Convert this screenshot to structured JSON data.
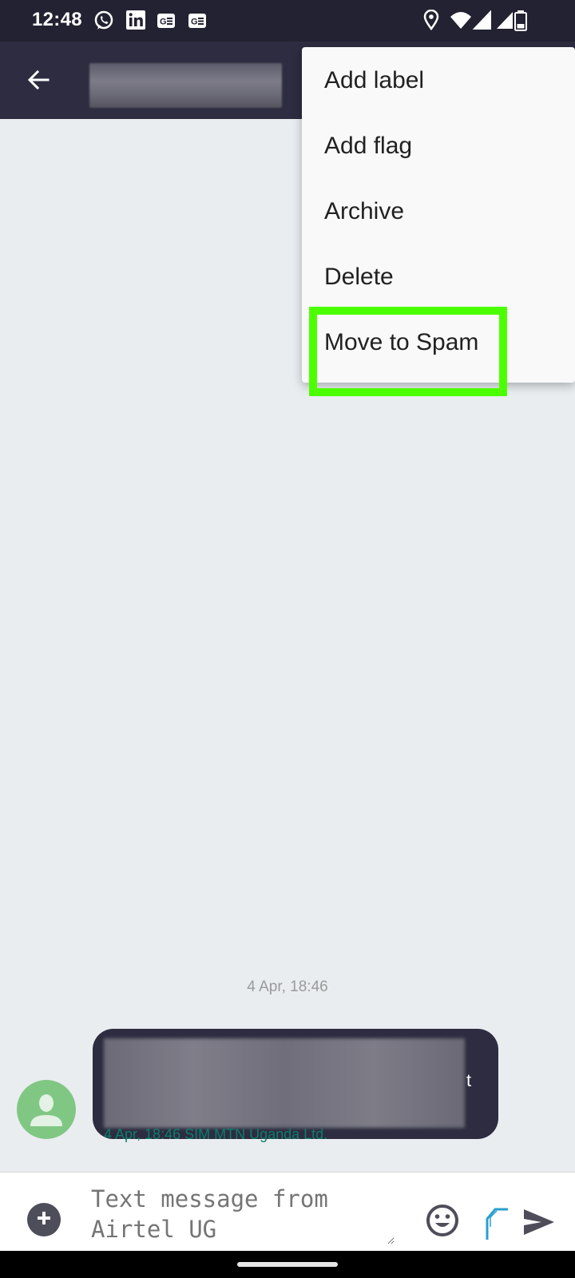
{
  "status_bar": {
    "time": "12:48",
    "notification_icons": [
      "whatsapp-icon",
      "linkedin-icon",
      "news-icon",
      "news-icon"
    ],
    "system_icons": [
      "location-icon",
      "wifi-icon",
      "signal-icon",
      "signal-icon",
      "battery-icon"
    ]
  },
  "app_bar": {
    "back_icon": "arrow-left-icon",
    "contact_name": "[blurred]"
  },
  "menu": {
    "items": [
      {
        "label": "Add label"
      },
      {
        "label": "Add flag"
      },
      {
        "label": "Archive"
      },
      {
        "label": "Delete"
      },
      {
        "label": "Move to Spam"
      }
    ],
    "highlighted_item": "Move to Spam",
    "highlight_color": "#4cff00"
  },
  "thread": {
    "date_divider": "4 Apr, 18:46",
    "messages": [
      {
        "direction": "incoming",
        "text": "[blurred]",
        "visible_fragment": "t",
        "meta": "4 Apr, 18:46 SIM MTN Uganda Ltd."
      }
    ]
  },
  "compose": {
    "placeholder": "Text message from Airtel UG",
    "attach_icon": "plus-circle-icon",
    "emoji_icon": "emoji-icon",
    "sim_icon": "sim-selector-icon",
    "send_icon": "send-icon"
  },
  "colors": {
    "status_bar": "#222232",
    "app_bar": "#2d2c40",
    "background": "#e9edf0",
    "bubble": "#2d2c40",
    "meta_text": "#0d7d6c",
    "avatar": "#81c784"
  }
}
